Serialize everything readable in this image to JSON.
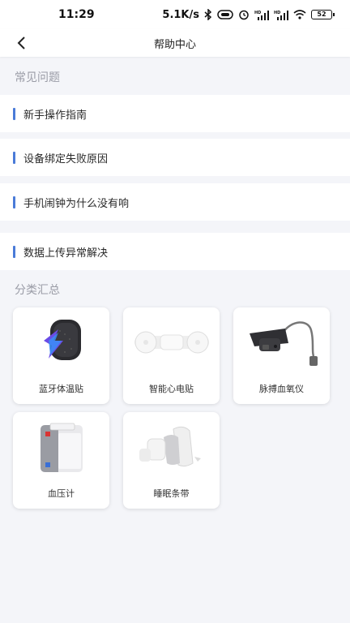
{
  "status_bar": {
    "time": "11:29",
    "network_speed": "5.1K/s",
    "battery": "52",
    "icons": [
      "bluetooth-icon",
      "vibrate-icon",
      "alarm-icon",
      "signal-hd-icon",
      "signal-hd-icon",
      "wifi-icon",
      "battery-icon"
    ]
  },
  "header": {
    "title": "帮助中心",
    "back_icon": "chevron-left-icon"
  },
  "faq": {
    "section_title": "常见问题",
    "items": [
      {
        "label": "新手操作指南"
      },
      {
        "label": "设备绑定失败原因"
      },
      {
        "label": "手机闹钟为什么没有响"
      },
      {
        "label": "数据上传异常解决"
      }
    ],
    "accent_color": "#4a7bd8"
  },
  "categories": {
    "section_title": "分类汇总",
    "items": [
      {
        "label": "蓝牙体温贴",
        "icon": "thermometer-patch-image"
      },
      {
        "label": "智能心电贴",
        "icon": "ecg-patch-image"
      },
      {
        "label": "脉搏血氧仪",
        "icon": "pulse-oximeter-image"
      },
      {
        "label": "血压计",
        "icon": "blood-pressure-monitor-image"
      },
      {
        "label": "睡眠条带",
        "icon": "sleep-band-image"
      }
    ]
  }
}
